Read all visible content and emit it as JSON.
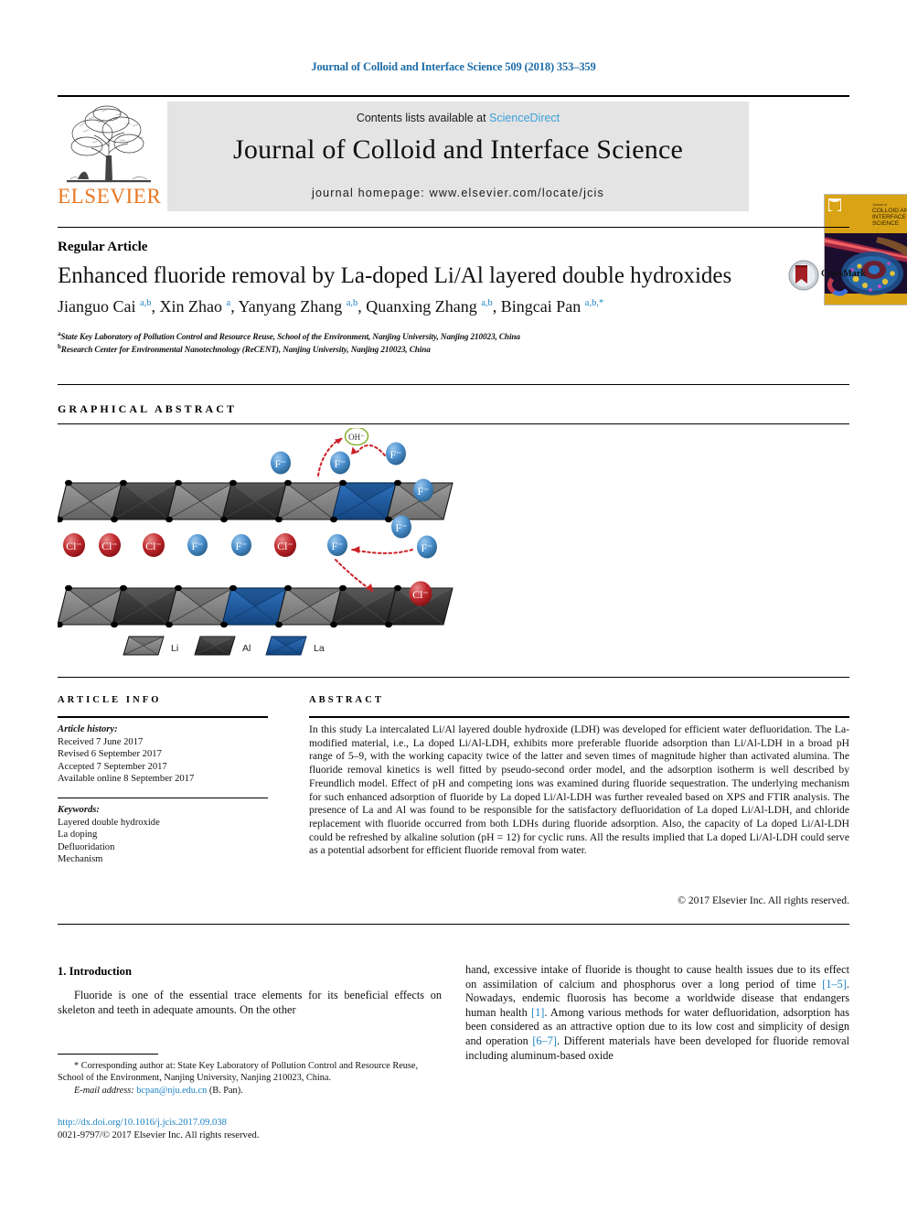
{
  "running_head": "Journal of Colloid and Interface Science 509 (2018) 353–359",
  "masthead": {
    "contents_prefix": "Contents lists available at ",
    "sciencedirect": "ScienceDirect",
    "journal_title": "Journal of Colloid and Interface Science",
    "homepage": "journal homepage: www.elsevier.com/locate/jcis",
    "publisher": "ELSEVIER",
    "cover_lines": [
      "Journal of",
      "COLLOID AND",
      "INTERFACE",
      "SCIENCE"
    ],
    "accent_link_color": "#3aa0d8",
    "band_color": "#e4e4e4",
    "elsevier_orange": "#e87722"
  },
  "article": {
    "type_label": "Regular Article",
    "title": "Enhanced fluoride removal by La-doped Li/Al layered double hydroxides",
    "crossmark_label": "CrossMark",
    "authors_html": "Jianguo Cai <sup>a,b</sup>, Xin Zhao <sup>a</sup>, Yanyang Zhang <sup>a,b</sup>, Quanxing Zhang <sup>a,b</sup>, Bingcai Pan <sup>a,b,</sup><sup>*</sup>",
    "affiliation_a": "State Key Laboratory of Pollution Control and Resource Reuse, School of the Environment, Nanjing University, Nanjing 210023, China",
    "affiliation_b": "Research Center for Environmental Nanotechnology (ReCENT), Nanjing University, Nanjing 210023, China"
  },
  "graphical_abstract": {
    "heading": "GRAPHICAL ABSTRACT",
    "legend": [
      {
        "label": "Li",
        "color": "#8a8a8a"
      },
      {
        "label": "Al",
        "color": "#3a3a3a"
      },
      {
        "label": "La",
        "color": "#1f5fa8"
      }
    ],
    "species": {
      "hydroxide": "OH-",
      "fluoride": "F-",
      "chloride": "Cl-"
    },
    "interlayer_ions": [
      "Cl-",
      "Cl-",
      "Cl-",
      "F-",
      "F-",
      "Cl-",
      "F-"
    ],
    "free_fluorides": 5,
    "colors": {
      "fluoride_blue": "#3d86c6",
      "chloride_red": "#c0272d",
      "hydroxide_green": "#8cb63c",
      "arrow_red": "#cc2027"
    }
  },
  "article_info": {
    "heading": "ARTICLE INFO",
    "history_label": "Article history:",
    "history": [
      "Received 7 June 2017",
      "Revised 6 September 2017",
      "Accepted 7 September 2017",
      "Available online 8 September 2017"
    ],
    "keywords_label": "Keywords:",
    "keywords": [
      "Layered double hydroxide",
      "La doping",
      "Defluoridation",
      "Mechanism"
    ]
  },
  "abstract": {
    "heading": "ABSTRACT",
    "text": "In this study La intercalated Li/Al layered double hydroxide (LDH) was developed for efficient water defluoridation. The La-modified material, i.e., La doped Li/Al-LDH, exhibits more preferable fluoride adsorption than Li/Al-LDH in a broad pH range of 5–9, with the working capacity twice of the latter and seven times of magnitude higher than activated alumina. The fluoride removal kinetics is well fitted by pseudo-second order model, and the adsorption isotherm is well described by Freundlich model. Effect of pH and competing ions was examined during fluoride sequestration. The underlying mechanism for such enhanced adsorption of fluoride by La doped Li/Al-LDH was further revealed based on XPS and FTIR analysis. The presence of La and Al was found to be responsible for the satisfactory defluoridation of La doped Li/Al-LDH, and chloride replacement with fluoride occurred from both LDHs during fluoride adsorption. Also, the capacity of La doped Li/Al-LDH could be refreshed by alkaline solution (pH = 12) for cyclic runs. All the results implied that La doped Li/Al-LDH could serve as a potential adsorbent for efficient fluoride removal from water.",
    "copyright": "© 2017 Elsevier Inc. All rights reserved."
  },
  "body": {
    "section_number_title": "1. Introduction",
    "left_paragraph": "Fluoride is one of the essential trace elements for its beneficial effects on skeleton and teeth in adequate amounts. On the other",
    "right_paragraph_parts": [
      "hand, excessive intake of fluoride is thought to cause health issues due to its effect on assimilation of calcium and phosphorus over a long period of time ",
      "[1–5]",
      ". Nowadays, endemic fluorosis has become a worldwide disease that endangers human health ",
      "[1]",
      ". Among various methods for water defluoridation, adsorption has been considered as an attractive option due to its low cost and simplicity of design and operation ",
      "[6–7]",
      ". Different materials have been developed for fluoride removal including aluminum-based oxide"
    ]
  },
  "footer": {
    "corresponding_marker": "*",
    "corresponding_text": "Corresponding author at: State Key Laboratory of Pollution Control and Resource Reuse, School of the Environment, Nanjing University, Nanjing 210023, China.",
    "email_label": "E-mail address:",
    "email": "bcpan@nju.edu.cn",
    "email_owner": "(B. Pan).",
    "doi": "http://dx.doi.org/10.1016/j.jcis.2017.09.038",
    "issn_line": "0021-9797/© 2017 Elsevier Inc. All rights reserved."
  }
}
